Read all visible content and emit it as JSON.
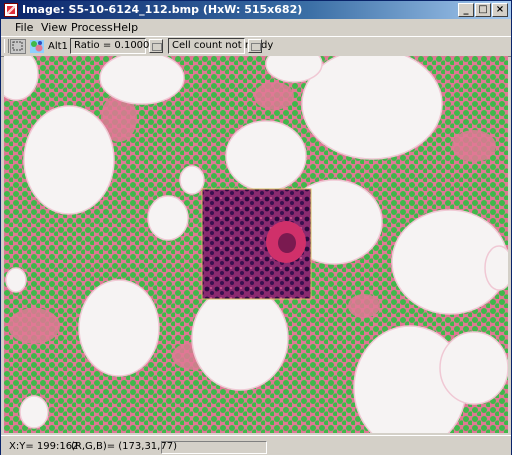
{
  "window": {
    "title": "Image: S5-10-6124_112.bmp (HxW: 515x682)",
    "minimize": "_",
    "maximize": "□",
    "close": "×"
  },
  "menu": [
    "File",
    "View",
    "Process",
    "Help"
  ],
  "toolbar": {
    "alt_label": "Alt1",
    "ratio": "Ratio = 0.100011",
    "cell_count": "Cell count not ready"
  },
  "status": {
    "xy": "X:Y= 199:162",
    "rgb": "(R,G,B)= (173,31,77)"
  },
  "colors": {
    "stroma": "#e07895",
    "cells_green": "#3fb84a",
    "fat": "#f6f3f3",
    "roi_dark": "#6a1a58",
    "nucleus": "#2a0a40",
    "megakaryocyte": "#d0306a",
    "selection": "#d8c060"
  }
}
